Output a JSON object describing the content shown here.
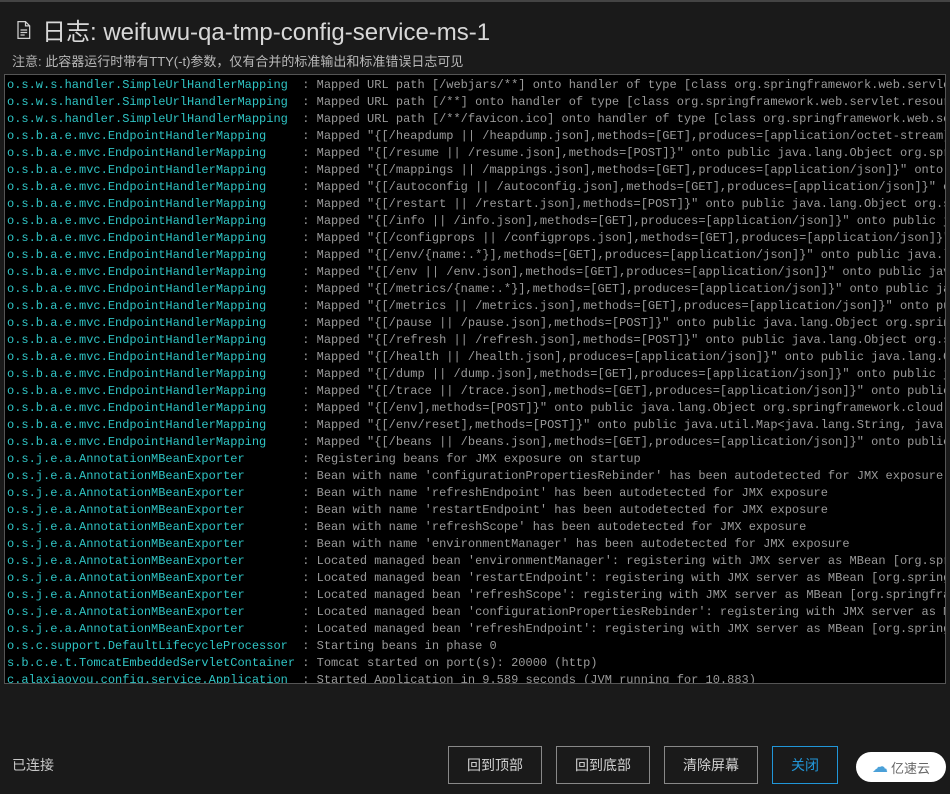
{
  "header": {
    "title_prefix": "日志:",
    "title_name": "weifuwu-qa-tmp-config-service-ms-1",
    "note_label": "注意:",
    "note_text": "此容器运行时带有TTY(-t)参数，仅有合并的标准输出和标准错误日志可见"
  },
  "log_lines": [
    {
      "src": "o.s.w.s.handler.SimpleUrlHandlerMapping  ",
      "msg": ": Mapped URL path [/webjars/**] onto handler of type [class org.springframework.web.servlet.resource"
    },
    {
      "src": "o.s.w.s.handler.SimpleUrlHandlerMapping  ",
      "msg": ": Mapped URL path [/**] onto handler of type [class org.springframework.web.servlet.resource.Resourc"
    },
    {
      "src": "o.s.w.s.handler.SimpleUrlHandlerMapping  ",
      "msg": ": Mapped URL path [/**/favicon.ico] onto handler of type [class org.springframework.web.servlet.reso"
    },
    {
      "src": "o.s.b.a.e.mvc.EndpointHandlerMapping     ",
      "msg": ": Mapped \"{[/heapdump || /heapdump.json],methods=[GET],produces=[application/octet-stream]}\" onto pub"
    },
    {
      "src": "o.s.b.a.e.mvc.EndpointHandlerMapping     ",
      "msg": ": Mapped \"{[/resume || /resume.json],methods=[POST]}\" onto public java.lang.Object org.springframewor"
    },
    {
      "src": "o.s.b.a.e.mvc.EndpointHandlerMapping     ",
      "msg": ": Mapped \"{[/mappings || /mappings.json],methods=[GET],produces=[application/json]}\" onto public java"
    },
    {
      "src": "o.s.b.a.e.mvc.EndpointHandlerMapping     ",
      "msg": ": Mapped \"{[/autoconfig || /autoconfig.json],methods=[GET],produces=[application/json]}\" onto public "
    },
    {
      "src": "o.s.b.a.e.mvc.EndpointHandlerMapping     ",
      "msg": ": Mapped \"{[/restart || /restart.json],methods=[POST]}\" onto public java.lang.Object org.springframew"
    },
    {
      "src": "o.s.b.a.e.mvc.EndpointHandlerMapping     ",
      "msg": ": Mapped \"{[/info || /info.json],methods=[GET],produces=[application/json]}\" onto public java.lang.Ob"
    },
    {
      "src": "o.s.b.a.e.mvc.EndpointHandlerMapping     ",
      "msg": ": Mapped \"{[/configprops || /configprops.json],methods=[GET],produces=[application/json]}\" onto publi"
    },
    {
      "src": "o.s.b.a.e.mvc.EndpointHandlerMapping     ",
      "msg": ": Mapped \"{[/env/{name:.*}],methods=[GET],produces=[application/json]}\" onto public java.lang.Object "
    },
    {
      "src": "o.s.b.a.e.mvc.EndpointHandlerMapping     ",
      "msg": ": Mapped \"{[/env || /env.json],methods=[GET],produces=[application/json]}\" onto public java.lang.Obje"
    },
    {
      "src": "o.s.b.a.e.mvc.EndpointHandlerMapping     ",
      "msg": ": Mapped \"{[/metrics/{name:.*}],methods=[GET],produces=[application/json]}\" onto public java.lang.Obj"
    },
    {
      "src": "o.s.b.a.e.mvc.EndpointHandlerMapping     ",
      "msg": ": Mapped \"{[/metrics || /metrics.json],methods=[GET],produces=[application/json]}\" onto public java.l"
    },
    {
      "src": "o.s.b.a.e.mvc.EndpointHandlerMapping     ",
      "msg": ": Mapped \"{[/pause || /pause.json],methods=[POST]}\" onto public java.lang.Object org.springframework."
    },
    {
      "src": "o.s.b.a.e.mvc.EndpointHandlerMapping     ",
      "msg": ": Mapped \"{[/refresh || /refresh.json],methods=[POST]}\" onto public java.lang.Object org.springframew"
    },
    {
      "src": "o.s.b.a.e.mvc.EndpointHandlerMapping     ",
      "msg": ": Mapped \"{[/health || /health.json],produces=[application/json]}\" onto public java.lang.Object org.s"
    },
    {
      "src": "o.s.b.a.e.mvc.EndpointHandlerMapping     ",
      "msg": ": Mapped \"{[/dump || /dump.json],methods=[GET],produces=[application/json]}\" onto public java.lang.Ob"
    },
    {
      "src": "o.s.b.a.e.mvc.EndpointHandlerMapping     ",
      "msg": ": Mapped \"{[/trace || /trace.json],methods=[GET],produces=[application/json]}\" onto public java.lang."
    },
    {
      "src": "o.s.b.a.e.mvc.EndpointHandlerMapping     ",
      "msg": ": Mapped \"{[/env],methods=[POST]}\" onto public java.lang.Object org.springframework.cloud.context.env"
    },
    {
      "src": "o.s.b.a.e.mvc.EndpointHandlerMapping     ",
      "msg": ": Mapped \"{[/env/reset],methods=[POST]}\" onto public java.util.Map<java.lang.String, java.lang.Object"
    },
    {
      "src": "o.s.b.a.e.mvc.EndpointHandlerMapping     ",
      "msg": ": Mapped \"{[/beans || /beans.json],methods=[GET],produces=[application/json]}\" onto public java.lang."
    },
    {
      "src": "o.s.j.e.a.AnnotationMBeanExporter        ",
      "msg": ": Registering beans for JMX exposure on startup"
    },
    {
      "src": "o.s.j.e.a.AnnotationMBeanExporter        ",
      "msg": ": Bean with name 'configurationPropertiesRebinder' has been autodetected for JMX exposure"
    },
    {
      "src": "o.s.j.e.a.AnnotationMBeanExporter        ",
      "msg": ": Bean with name 'refreshEndpoint' has been autodetected for JMX exposure"
    },
    {
      "src": "o.s.j.e.a.AnnotationMBeanExporter        ",
      "msg": ": Bean with name 'restartEndpoint' has been autodetected for JMX exposure"
    },
    {
      "src": "o.s.j.e.a.AnnotationMBeanExporter        ",
      "msg": ": Bean with name 'refreshScope' has been autodetected for JMX exposure"
    },
    {
      "src": "o.s.j.e.a.AnnotationMBeanExporter        ",
      "msg": ": Bean with name 'environmentManager' has been autodetected for JMX exposure"
    },
    {
      "src": "o.s.j.e.a.AnnotationMBeanExporter        ",
      "msg": ": Located managed bean 'environmentManager': registering with JMX server as MBean [org.springframewor"
    },
    {
      "src": "o.s.j.e.a.AnnotationMBeanExporter        ",
      "msg": ": Located managed bean 'restartEndpoint': registering with JMX server as MBean [org.springframework.c"
    },
    {
      "src": "o.s.j.e.a.AnnotationMBeanExporter        ",
      "msg": ": Located managed bean 'refreshScope': registering with JMX server as MBean [org.springframework.clou"
    },
    {
      "src": "o.s.j.e.a.AnnotationMBeanExporter        ",
      "msg": ": Located managed bean 'configurationPropertiesRebinder': registering with JMX server as MBean [org.s"
    },
    {
      "src": "o.s.j.e.a.AnnotationMBeanExporter        ",
      "msg": ": Located managed bean 'refreshEndpoint': registering with JMX server as MBean [org.springframework.c"
    },
    {
      "src": "o.s.c.support.DefaultLifecycleProcessor  ",
      "msg": ": Starting beans in phase 0"
    },
    {
      "src": "s.b.c.e.t.TomcatEmbeddedServletContainer ",
      "msg": ": Tomcat started on port(s): 20000 (http)"
    },
    {
      "src": "c.alaxiaoyou.config.service.Application  ",
      "msg": ": Started Application in 9.589 seconds (JVM running for 10.883)"
    }
  ],
  "footer": {
    "status": "已连接",
    "buttons": {
      "scroll_top": "回到顶部",
      "scroll_bottom": "回到底部",
      "clear": "清除屏幕",
      "close": "关闭"
    },
    "brand": "亿速云"
  }
}
